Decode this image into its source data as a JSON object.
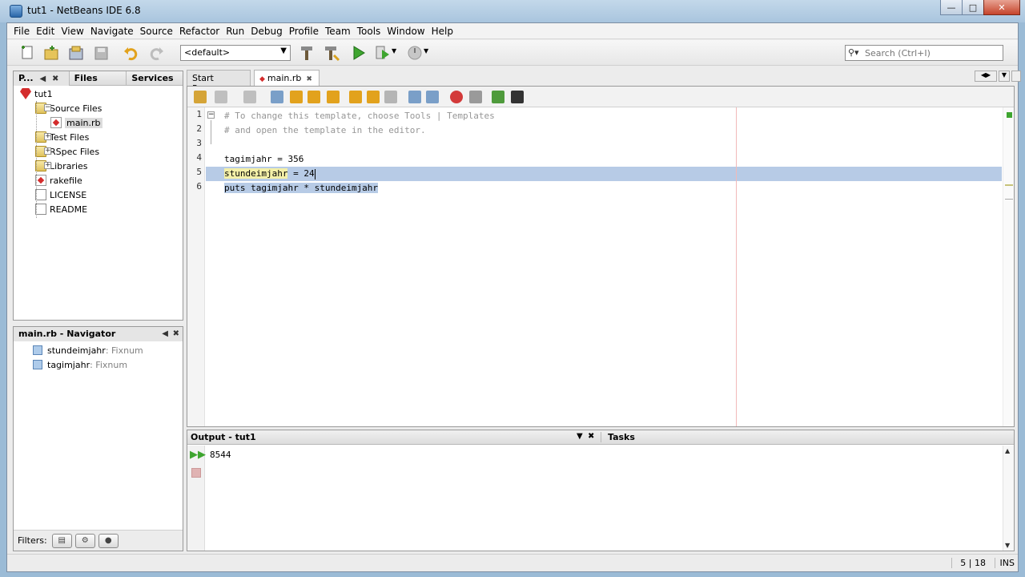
{
  "window": {
    "title": "tut1 - NetBeans IDE 6.8"
  },
  "menu": [
    "File",
    "Edit",
    "View",
    "Navigate",
    "Source",
    "Refactor",
    "Run",
    "Debug",
    "Profile",
    "Team",
    "Tools",
    "Window",
    "Help"
  ],
  "toolbar": {
    "config_value": "<default>",
    "search_placeholder": "Search (Ctrl+I)"
  },
  "projects_panel": {
    "tabs": [
      "P...",
      "Files",
      "Services"
    ],
    "tree": [
      {
        "label": "tut1",
        "level": 0,
        "icon": "ruby-project-icon"
      },
      {
        "label": "Source Files",
        "level": 1,
        "icon": "folder-icon",
        "expanded": true
      },
      {
        "label": "main.rb",
        "level": 2,
        "icon": "ruby-file-icon",
        "selected": true
      },
      {
        "label": "Test Files",
        "level": 1,
        "icon": "folder-icon",
        "expanded": false
      },
      {
        "label": "RSpec Files",
        "level": 1,
        "icon": "folder-icon",
        "expanded": false
      },
      {
        "label": "Libraries",
        "level": 1,
        "icon": "folder-icon",
        "expanded": false
      },
      {
        "label": "rakefile",
        "level": 1,
        "icon": "ruby-file-icon"
      },
      {
        "label": "LICENSE",
        "level": 1,
        "icon": "file-icon"
      },
      {
        "label": "README",
        "level": 1,
        "icon": "file-icon"
      }
    ]
  },
  "navigator": {
    "title": "main.rb - Navigator",
    "items": [
      {
        "name": "stundeimjahr",
        "type": " : Fixnum"
      },
      {
        "name": "tagimjahr",
        "type": " : Fixnum"
      }
    ],
    "filters_label": "Filters:"
  },
  "editor": {
    "tabs": [
      {
        "label": "Start Page"
      },
      {
        "label": "main.rb"
      }
    ],
    "lines": [
      {
        "n": "1",
        "text": "# To change this template, choose Tools | Templates",
        "kind": "comment"
      },
      {
        "n": "2",
        "text": "# and open the template in the editor.",
        "kind": "comment"
      },
      {
        "n": "3",
        "text": "",
        "kind": "code"
      },
      {
        "n": "4",
        "text": "tagimjahr = 356",
        "kind": "code"
      },
      {
        "n": "5",
        "text": "stundeimjahr = 24",
        "kind": "code"
      },
      {
        "n": "6",
        "text": "puts tagimjahr * stundeimjahr",
        "kind": "code"
      }
    ]
  },
  "output": {
    "title": "Output - tut1",
    "tasks_title": "Tasks",
    "text": "8544"
  },
  "status": {
    "position": "5 | 18",
    "mode": "INS"
  },
  "colors": {
    "comment": "#969696",
    "selection": "#b7cbe6",
    "highlight_yellow": "#f4f0a8"
  }
}
